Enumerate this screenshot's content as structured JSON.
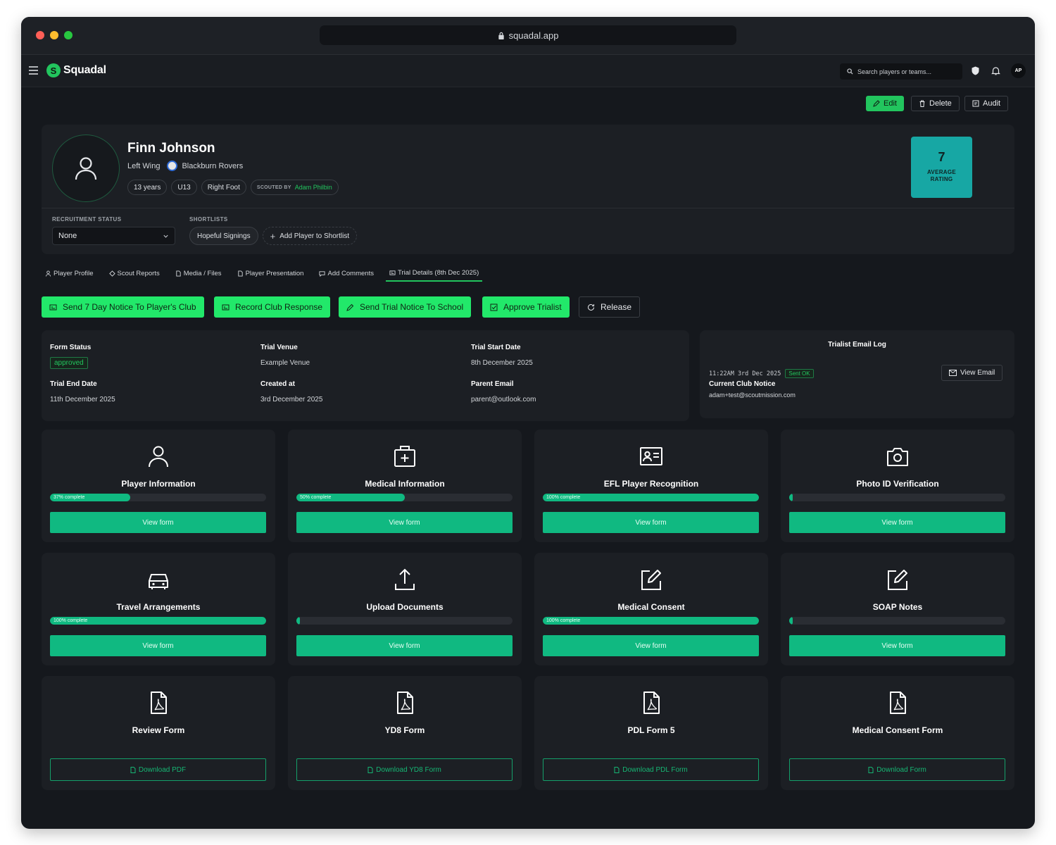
{
  "browser": {
    "url": "squadal.app"
  },
  "app": {
    "name": "Squadal",
    "search_placeholder": "Search players or teams...",
    "user_initials": "AP"
  },
  "actions": {
    "edit": "Edit",
    "delete": "Delete",
    "audit": "Audit"
  },
  "player": {
    "name": "Finn Johnson",
    "position": "Left Wing",
    "club": "Blackburn Rovers",
    "age": "13 years",
    "group": "U13",
    "foot": "Right Foot",
    "scouted_by_label": "SCOUTED BY",
    "scout": "Adam Philbin",
    "rating": "7",
    "rating_label": "AVERAGE RATING"
  },
  "recruitment": {
    "status_label": "RECRUITMENT STATUS",
    "status_value": "None",
    "shortlists_label": "SHORTLISTS",
    "shortlist": "Hopeful Signings",
    "add_shortlist": "Add Player to Shortlist"
  },
  "tabs": [
    {
      "label": "Player Profile",
      "icon": "user-icon"
    },
    {
      "label": "Scout Reports",
      "icon": "target-icon"
    },
    {
      "label": "Media / Files",
      "icon": "file-icon"
    },
    {
      "label": "Player Presentation",
      "icon": "file-icon"
    },
    {
      "label": "Add Comments",
      "icon": "comment-icon"
    },
    {
      "label": "Trial Details (8th Dec 2025)",
      "icon": "id-card-icon",
      "active": true
    }
  ],
  "trial_actions": [
    "Send 7 Day Notice To Player's Club",
    "Record Club Response",
    "Send Trial Notice To School",
    "Approve Trialist",
    "Release"
  ],
  "trial_info": {
    "form_status_label": "Form Status",
    "form_status": "approved",
    "venue_label": "Trial Venue",
    "venue": "Example Venue",
    "start_label": "Trial Start Date",
    "start": "8th December 2025",
    "end_label": "Trial End Date",
    "end": "11th December 2025",
    "created_label": "Created at",
    "created": "3rd December 2025",
    "parent_email_label": "Parent Email",
    "parent_email": "parent@outlook.com"
  },
  "email_log": {
    "title": "Trialist Email Log",
    "time": "11:22AM 3rd Dec 2025",
    "status": "Sent OK",
    "subject": "Current Club Notice",
    "address": "adam+test@scoutmission.com",
    "view": "View Email"
  },
  "forms": [
    {
      "title": "Player Information",
      "icon": "user-icon",
      "progress": 37,
      "progress_label": "37% complete",
      "button": "View form"
    },
    {
      "title": "Medical Information",
      "icon": "medical-bag-icon",
      "progress": 50,
      "progress_label": "50% complete",
      "button": "View form"
    },
    {
      "title": "EFL Player Recognition",
      "icon": "id-card-icon",
      "progress": 100,
      "progress_label": "100% complete",
      "button": "View form"
    },
    {
      "title": "Photo ID Verification",
      "icon": "camera-icon",
      "progress": 0,
      "progress_label": "",
      "button": "View form"
    },
    {
      "title": "Travel Arrangements",
      "icon": "car-icon",
      "progress": 100,
      "progress_label": "100% complete",
      "button": "View form"
    },
    {
      "title": "Upload Documents",
      "icon": "upload-icon",
      "progress": 0,
      "progress_label": "",
      "button": "View form"
    },
    {
      "title": "Medical Consent",
      "icon": "edit-icon",
      "progress": 100,
      "progress_label": "100% complete",
      "button": "View form"
    },
    {
      "title": "SOAP Notes",
      "icon": "edit-icon",
      "progress": 0,
      "progress_label": "",
      "button": "View form"
    }
  ],
  "downloads": [
    {
      "title": "Review Form",
      "icon": "pdf-icon",
      "button": "Download PDF"
    },
    {
      "title": "YD8 Form",
      "icon": "pdf-icon",
      "button": "Download YD8 Form"
    },
    {
      "title": "PDL Form 5",
      "icon": "pdf-icon",
      "button": "Download PDL Form"
    },
    {
      "title": "Medical Consent Form",
      "icon": "pdf-icon",
      "button": "Download Form"
    }
  ],
  "colors": {
    "accent": "#22c55e",
    "form_green": "#10b981",
    "rating_bg": "#17a7a4",
    "bg": "#15181d",
    "card": "#1c1f24"
  }
}
